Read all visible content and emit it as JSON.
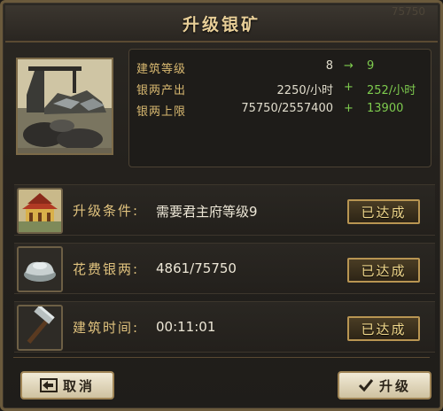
{
  "dialog": {
    "title": "升级银矿",
    "watermark": "75750"
  },
  "stats": [
    {
      "label": "建筑等级",
      "current": "8",
      "op": "→",
      "next": "9"
    },
    {
      "label": "银两产出",
      "current": "2250/小时",
      "op": "+",
      "next": "252/小时"
    },
    {
      "label": "银两上限",
      "current": "75750/2557400",
      "op": "+",
      "next": "13900"
    }
  ],
  "conditions": [
    {
      "label": "升级条件:",
      "value": "需要君主府等级9",
      "status": "已达成",
      "icon": "palace-icon"
    },
    {
      "label": "花费银两:",
      "value": "4861/75750",
      "status": "已达成",
      "icon": "silver-ingot-icon"
    },
    {
      "label": "建筑时间:",
      "value": "00:11:01",
      "status": "已达成",
      "icon": "hammer-icon"
    }
  ],
  "buttons": {
    "cancel": "取消",
    "upgrade": "升级"
  },
  "colors": {
    "gold_label": "#d8b870",
    "green_increase": "#7ecb4e",
    "panel_bg": "#1e1c19"
  }
}
